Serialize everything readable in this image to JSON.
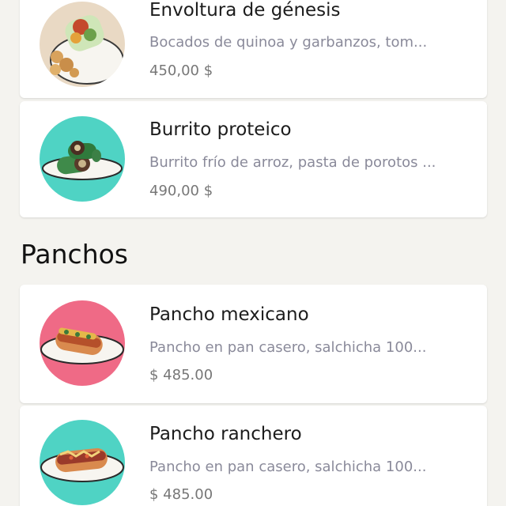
{
  "sections": [
    {
      "items": [
        {
          "name": "Envoltura de génesis",
          "description": "Bocados de quinoa y garbanzos, tom...",
          "price": "450,00 $",
          "image": "wrap-with-bites-photo"
        },
        {
          "name": "Burrito proteico",
          "description": "Burrito frío de arroz, pasta de porotos ...",
          "price": "490,00 $",
          "image": "burrito-plate-photo",
          "thumb_bg": "#4fd3c4"
        }
      ]
    },
    {
      "title": "Panchos",
      "items": [
        {
          "name": "Pancho mexicano",
          "description": "Pancho en pan casero, salchicha 100...",
          "price": "$ 485.00",
          "image": "hotdog-plate-photo",
          "thumb_bg": "#ef6a86"
        },
        {
          "name": "Pancho ranchero",
          "description": "Pancho en pan casero, salchicha 100...",
          "price": "$ 485.00",
          "image": "hotdog-plate-photo",
          "thumb_bg": "#4fd3c4"
        }
      ]
    }
  ]
}
